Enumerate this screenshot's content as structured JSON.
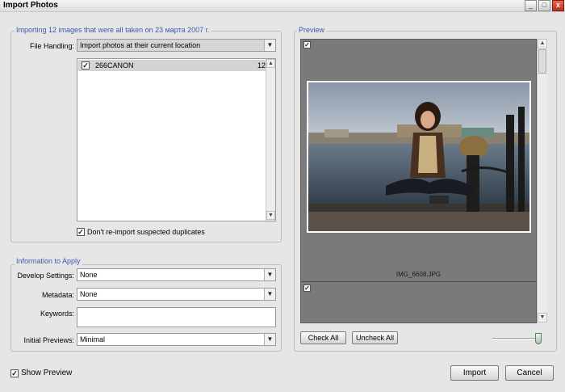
{
  "window": {
    "title": "Import Photos",
    "minimize_glyph": "_",
    "maximize_glyph": "□",
    "close_glyph": "x"
  },
  "import_group": {
    "legend": "Importing 12 images that were all taken on 23 марта 2007 г.",
    "file_handling_label": "File Handling:",
    "file_handling_value": "Import photos at their current location",
    "folders": [
      {
        "name": "266CANON",
        "count": "12",
        "checked": true
      }
    ],
    "duplicates_label": "Don't re-import suspected duplicates",
    "duplicates_checked": true
  },
  "info_group": {
    "legend": "Information to Apply",
    "develop_label": "Develop Settings:",
    "develop_value": "None",
    "metadata_label": "Metadata:",
    "metadata_value": "None",
    "keywords_label": "Keywords:",
    "keywords_value": "",
    "previews_label": "Initial Previews:",
    "previews_value": "Minimal"
  },
  "preview_group": {
    "legend": "Preview",
    "thumbnails": [
      {
        "filename": "IMG_6608.JPG",
        "checked": true
      },
      {
        "filename": "",
        "checked": true
      }
    ],
    "check_all_label": "Check All",
    "uncheck_all_label": "Uncheck All",
    "thumbnail_size_level": 1.0
  },
  "footer": {
    "show_preview_label": "Show Preview",
    "show_preview_checked": true,
    "import_label": "Import",
    "cancel_label": "Cancel"
  },
  "icons": {
    "check": "✓",
    "down_arrow": "▼",
    "up_arrow": "▲"
  }
}
